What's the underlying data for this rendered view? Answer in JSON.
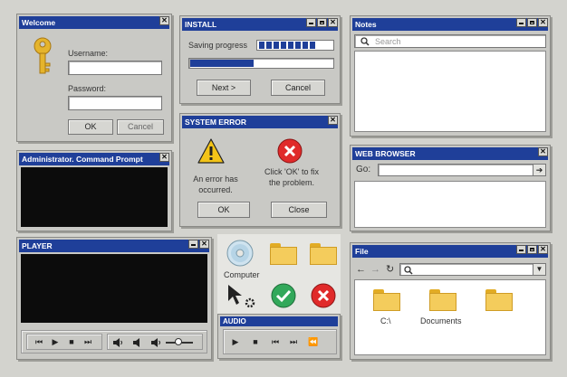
{
  "welcome": {
    "title": "Welcome",
    "username_label": "Username:",
    "password_label": "Password:",
    "ok": "OK",
    "cancel": "Cancel"
  },
  "install": {
    "title": "INSTALL",
    "progress_label": "Saving progress",
    "progress": 0.45,
    "next": "Next >",
    "cancel": "Cancel"
  },
  "notes": {
    "title": "Notes",
    "search_placeholder": "Search"
  },
  "error": {
    "title": "SYSTEM ERROR",
    "msg1": "An error has occurred.",
    "msg2": "Click 'OK' to fix the problem.",
    "ok": "OK",
    "close": "Close"
  },
  "cmd": {
    "title": "Administrator. Command Prompt"
  },
  "browser": {
    "title": "WEB BROWSER",
    "go": "Go:"
  },
  "player": {
    "title": "PLAYER",
    "volume": 0.45
  },
  "icons": {
    "computer": "Computer"
  },
  "audio": {
    "title": "AUDIO"
  },
  "file": {
    "title": "File",
    "folders": [
      "C:\\",
      "Documents",
      ""
    ]
  },
  "accent": "#1f3f99"
}
